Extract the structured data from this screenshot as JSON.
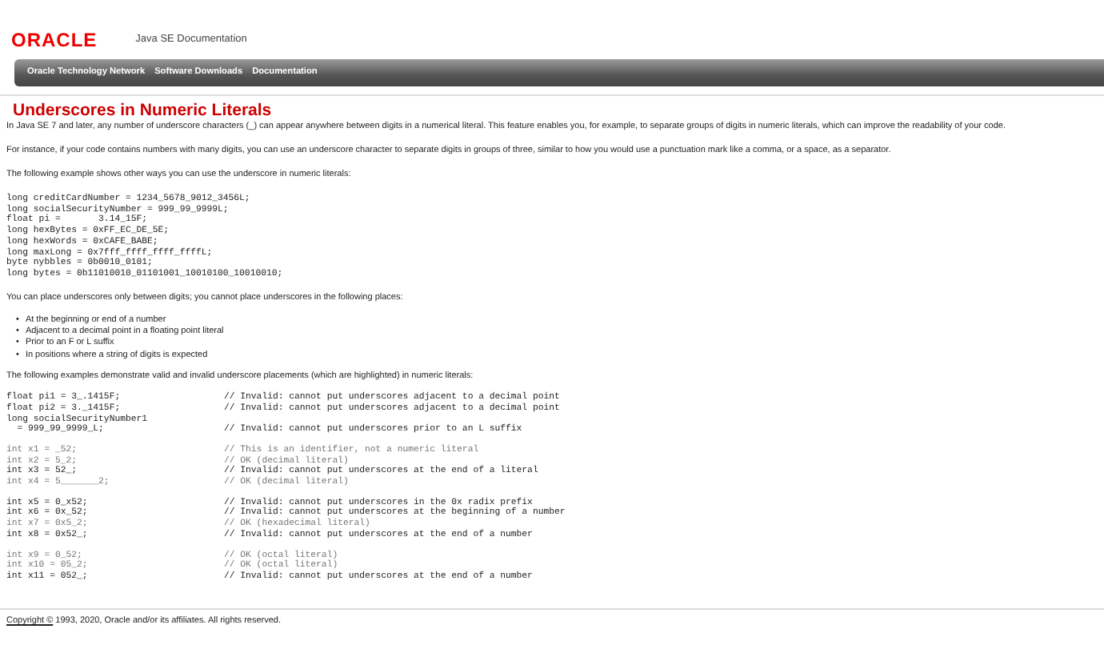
{
  "header": {
    "logo": "ORACLE",
    "title": "Java SE Documentation"
  },
  "nav": [
    "Oracle Technology Network",
    "Software Downloads",
    "Documentation"
  ],
  "heading": "Underscores in Numeric Literals",
  "intro": [
    "In Java SE 7 and later, any number of underscore characters (_) can appear anywhere between digits in a numerical literal. This feature enables you, for example, to separate groups of digits in numeric literals, which can improve the readability of your code.",
    "For instance, if your code contains numbers with many digits, you can use an underscore character to separate digits in groups of three, similar to how you would use a punctuation mark like a comma, or a space, as a separator.",
    "The following example shows other ways you can use the underscore in numeric literals:"
  ],
  "example": [
    "long creditCardNumber = 1234_5678_9012_3456L;",
    "long socialSecurityNumber = 999_99_9999L;",
    "float pi =       3.14_15F;",
    "long hexBytes = 0xFF_EC_DE_5E;",
    "long hexWords = 0xCAFE_BABE;",
    "long maxLong = 0x7fff_ffff_ffff_ffffL;",
    "byte nybbles = 0b0010_0101;",
    "long bytes = 0b11010010_01101001_10010100_10010010;"
  ],
  "rules_intro": "You can place underscores only between digits; you cannot place underscores in the following places:",
  "bullet": "•",
  "rules": [
    "At the beginning or end of a number",
    "Adjacent to a decimal point in a floating point literal",
    "Prior to an F or L suffix",
    "In positions where a string of digits is expected"
  ],
  "examples_intro": "The following examples demonstrate valid and invalid underscore placements (which are highlighted) in numeric literals:",
  "examples": [
    [
      {
        "code": "float pi1 = 3_.1415F;",
        "comment": "// Invalid: cannot put underscores adjacent to a decimal point",
        "highlighted": true
      },
      {
        "code": "float pi2 = 3._1415F;",
        "comment": "// Invalid: cannot put underscores adjacent to a decimal point",
        "highlighted": true
      },
      {
        "code": "long socialSecurityNumber1",
        "highlighted": true
      },
      {
        "code": "  = 999_99_9999_L;",
        "comment": "// Invalid: cannot put underscores prior to an L suffix",
        "highlighted": true
      }
    ],
    [
      {
        "code": "int x1 = _52;",
        "comment": "// This is an identifier, not a numeric literal",
        "highlighted": false
      },
      {
        "code": "int x2 = 5_2;",
        "comment": "// OK (decimal literal)",
        "highlighted": false
      },
      {
        "code": "int x3 = 52_;",
        "comment": "// Invalid: cannot put underscores at the end of a literal",
        "highlighted": true
      },
      {
        "code": "int x4 = 5_______2;",
        "comment": "// OK (decimal literal)",
        "highlighted": false
      }
    ],
    [
      {
        "code": "int x5 = 0_x52;",
        "comment": "// Invalid: cannot put underscores in the 0x radix prefix",
        "highlighted": true
      },
      {
        "code": "int x6 = 0x_52;",
        "comment": "// Invalid: cannot put underscores at the beginning of a number",
        "highlighted": true
      },
      {
        "code": "int x7 = 0x5_2;",
        "comment": "// OK (hexadecimal literal)",
        "highlighted": false
      },
      {
        "code": "int x8 = 0x52_;",
        "comment": "// Invalid: cannot put underscores at the end of a number",
        "highlighted": true
      }
    ],
    [
      {
        "code": "int x9 = 0_52;",
        "comment": "// OK (octal literal)",
        "highlighted": false
      },
      {
        "code": "int x10 = 05_2;",
        "comment": "// OK (octal literal)",
        "highlighted": false
      },
      {
        "code": "int x11 = 052_;",
        "comment": "// Invalid: cannot put underscores at the end of a number",
        "highlighted": true
      }
    ]
  ],
  "footer": {
    "link": "Copyright ©",
    "text": "1993, 2020, Oracle and/or its affiliates. All rights reserved."
  }
}
